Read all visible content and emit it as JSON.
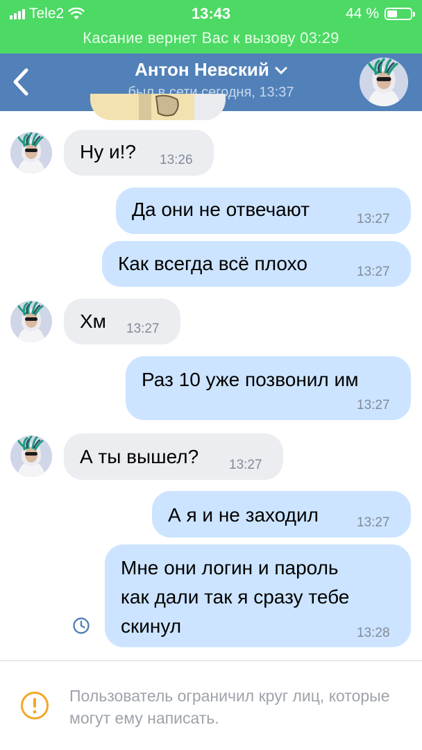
{
  "status_bar": {
    "carrier": "Tele2",
    "time": "13:43",
    "battery": "44 %",
    "battery_level": 0.44
  },
  "call_banner": "Касание вернет Вас к вызову 03:29",
  "header": {
    "title": "Антон Невский",
    "subtitle": "был в сети сегодня, 13:37"
  },
  "messages": [
    {
      "dir": "in",
      "text": "Ну и!?",
      "time": "13:26"
    },
    {
      "dir": "out",
      "text": "Да они не отвечают",
      "time": "13:27"
    },
    {
      "dir": "out",
      "text": "Как всегда всё плохо",
      "time": "13:27"
    },
    {
      "dir": "in",
      "text": "Хм",
      "time": "13:27"
    },
    {
      "dir": "out",
      "text": "Раз 10 уже позвонил им",
      "time": "13:27"
    },
    {
      "dir": "in",
      "text": "А ты вышел?",
      "time": "13:27"
    },
    {
      "dir": "out",
      "text": "А я и не заходил",
      "time": "13:27"
    },
    {
      "dir": "out",
      "lines": [
        "Мне они логин и пароль",
        "как дали так я сразу тебе",
        "скинул"
      ],
      "time": "13:28",
      "status": "clock-icon"
    }
  ],
  "notice": {
    "icon": "warning-icon",
    "text": "Пользователь ограничил круг лиц, которые могут ему написать."
  },
  "colors": {
    "status_green": "#4cd964",
    "header_blue": "#5181b8",
    "bubble_out": "#cce4ff",
    "bubble_in": "#ebedf0",
    "time_gray": "#828a99"
  }
}
